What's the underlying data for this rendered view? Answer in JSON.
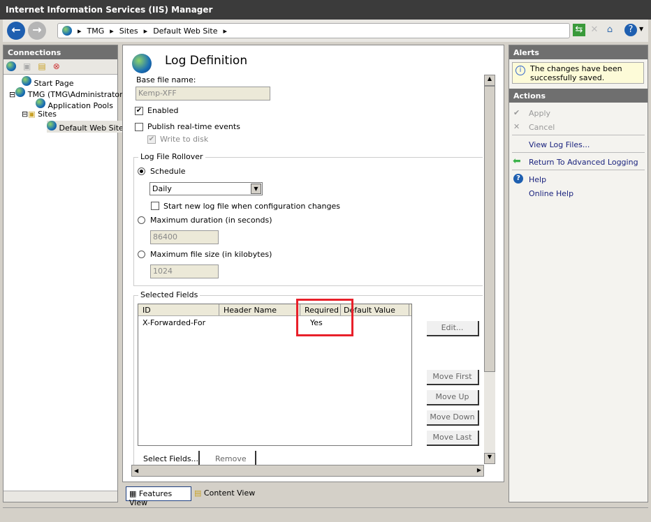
{
  "window": {
    "title": "Internet Information Services (IIS) Manager"
  },
  "nav": {
    "breadcrumb": [
      "TMG",
      "Sites",
      "Default Web Site"
    ]
  },
  "connections": {
    "title": "Connections",
    "tree": [
      "Start Page",
      "TMG (TMG\\Administrator)",
      "Application Pools",
      "Sites",
      "Default Web Site"
    ]
  },
  "main": {
    "title": "Log Definition",
    "base_file_label": "Base file name:",
    "base_file_value": "Kemp-XFF",
    "enabled_label": "Enabled",
    "enabled": true,
    "publish_label": "Publish real-time events",
    "publish": false,
    "write_disk_label": "Write to disk",
    "write_disk": true,
    "rollover": {
      "title": "Log File Rollover",
      "schedule_label": "Schedule",
      "schedule_value": "Daily",
      "new_file_label": "Start new log file when configuration changes",
      "max_duration_label": "Maximum duration (in seconds)",
      "max_duration_value": "86400",
      "max_size_label": "Maximum file size (in kilobytes)",
      "max_size_value": "1024"
    },
    "fields": {
      "title": "Selected Fields",
      "columns": [
        "ID",
        "Header Name",
        "Required",
        "Default Value"
      ],
      "rows": [
        [
          "X-Forwarded-For",
          "",
          "Yes",
          ""
        ]
      ],
      "buttons": {
        "edit": "Edit...",
        "move_first": "Move First",
        "move_up": "Move Up",
        "move_down": "Move Down",
        "move_last": "Move Last",
        "select": "Select Fields...",
        "remove": "Remove"
      }
    }
  },
  "views": {
    "features": "Features View",
    "content": "Content View"
  },
  "alerts": {
    "title": "Alerts",
    "message": "The changes have been successfully saved."
  },
  "actions": {
    "title": "Actions",
    "apply": "Apply",
    "cancel": "Cancel",
    "view_logs": "View Log Files...",
    "return": "Return To Advanced Logging",
    "help": "Help",
    "online_help": "Online Help"
  },
  "colors": {
    "highlight_box": "#e8202a",
    "link": "#1a237e"
  }
}
